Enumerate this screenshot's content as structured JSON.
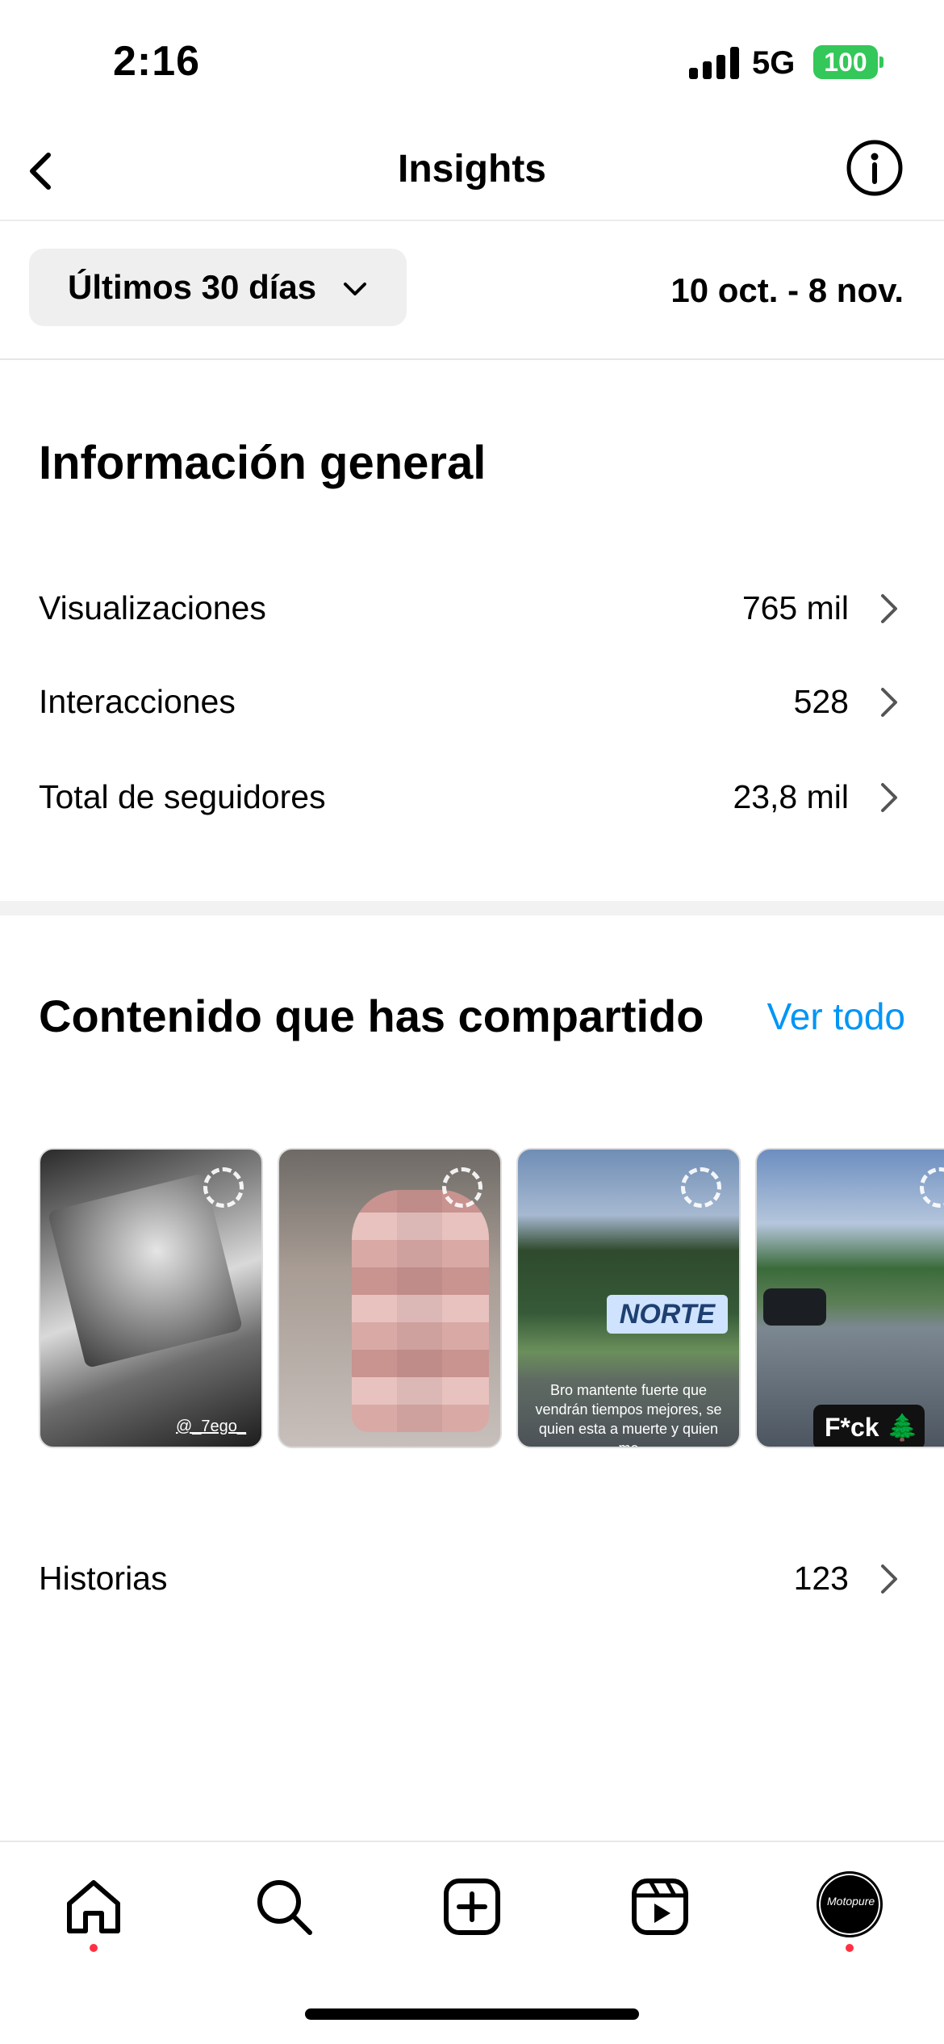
{
  "status_bar": {
    "time": "2:16",
    "network": "5G",
    "battery": "100"
  },
  "header": {
    "title": "Insights",
    "back_icon": "chevron-left-icon",
    "info_icon": "info-icon"
  },
  "filter": {
    "range_label": "Últimos 30 días",
    "date_range": "10 oct. - 8 nov."
  },
  "overview": {
    "title": "Información general",
    "metrics": [
      {
        "label": "Visualizaciones",
        "value": "765 mil"
      },
      {
        "label": "Interacciones",
        "value": "528"
      },
      {
        "label": "Total de seguidores",
        "value": "23,8 mil"
      }
    ]
  },
  "content": {
    "title": "Contenido que has compartido",
    "see_all": "Ver todo",
    "thumbnails": [
      {
        "caption": "@_7ego_"
      },
      {
        "caption": ""
      },
      {
        "caption": "Bro mantente fuerte que vendrán tiempos mejores, se quien esta a muerte y quien me",
        "graffiti": "NORTE"
      },
      {
        "caption": "F*ck 🌲"
      }
    ],
    "stories": {
      "label": "Historias",
      "value": "123"
    }
  },
  "tabbar": {
    "items": [
      "home-icon",
      "search-icon",
      "create-icon",
      "reels-icon",
      "profile-avatar"
    ],
    "avatar_text": "Motopure"
  },
  "colors": {
    "accent": "#0095f6",
    "notification": "#ff3040",
    "battery": "#34c759"
  }
}
